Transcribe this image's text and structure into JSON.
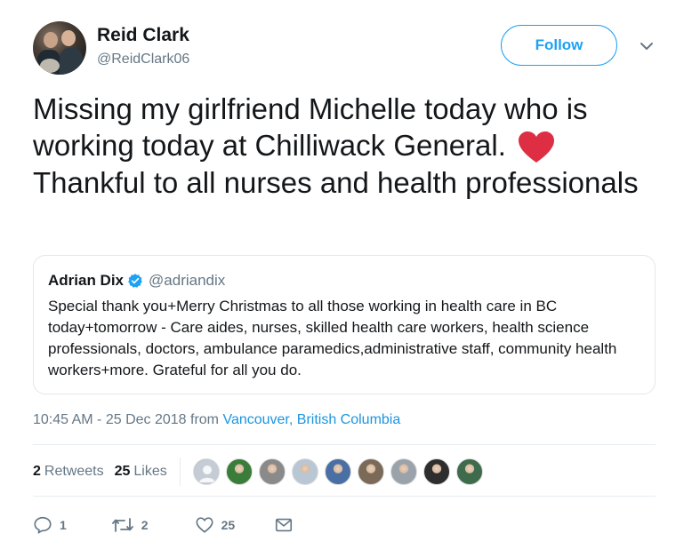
{
  "user": {
    "name": "Reid Clark",
    "handle": "@ReidClark06",
    "follow_label": "Follow"
  },
  "tweet": {
    "text": "Missing my girlfriend Michelle today who is working today at Chilliwack General.",
    "text_after_heart": "Thankful to all nurses and health professionals",
    "emoji": "heart-emoji"
  },
  "quote": {
    "name": "Adrian Dix",
    "handle": "@adriandix",
    "text": "Special thank you+Merry Christmas to all those working in health care in BC today+tomorrow - Care aides, nurses, skilled health care workers, health science professionals, doctors, ambulance paramedics,administrative staff, community health workers+more. Grateful for all you do."
  },
  "meta": {
    "time": "10:45 AM - 25 Dec 2018 from ",
    "location": "Vancouver, British Columbia"
  },
  "stats": {
    "retweets_count": "2",
    "retweets_label": "Retweets",
    "likes_count": "25",
    "likes_label": "Likes"
  },
  "likers": [
    {
      "icon": "default-avatar",
      "color": "#a9b4bd"
    },
    {
      "icon": "ohi-logo-avatar",
      "color": "#3a7d3a"
    },
    {
      "icon": "text-avatar",
      "color": "#8a8a8a"
    },
    {
      "icon": "woman-avatar",
      "color": "#b9c7d4"
    },
    {
      "icon": "man-avatar",
      "color": "#4a6fa5"
    },
    {
      "icon": "group-avatar",
      "color": "#7b6a58"
    },
    {
      "icon": "man-avatar",
      "color": "#9aa3ab"
    },
    {
      "icon": "man-dark-avatar",
      "color": "#2e2e2e"
    },
    {
      "icon": "man-green-avatar",
      "color": "#3d6b4b"
    }
  ],
  "actions": {
    "reply_count": "1",
    "retweet_count": "2",
    "like_count": "25"
  },
  "colors": {
    "accent": "#1da1f2",
    "link": "#1b95e0",
    "muted": "#657786",
    "heart": "#e0245e"
  }
}
